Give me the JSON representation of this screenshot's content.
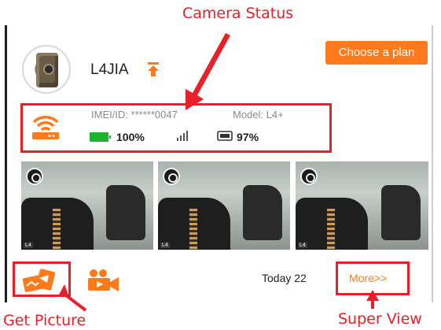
{
  "annotations": {
    "camera_status": "Camera Status",
    "get_picture": "Get Picture",
    "super_view": "Super View"
  },
  "camera": {
    "name": "L4JIA",
    "imei_label": "IMEI/ID: ******0047",
    "model_label": "Model: L4+",
    "battery": "100%",
    "storage": "97%"
  },
  "header": {
    "choose_plan_label": "Choose a plan"
  },
  "photos": {
    "tag": "L4",
    "count": 3
  },
  "footer": {
    "today_label": "Today 22",
    "more_label": "More>>"
  },
  "colors": {
    "accent": "#ff7a1a",
    "annotation": "#e8202a",
    "battery": "#1db32c"
  },
  "icons": [
    "pin-icon",
    "wifi-router-icon",
    "battery-icon",
    "signal-icon",
    "sd-card-icon",
    "view-icon",
    "get-picture-icon",
    "video-camera-icon"
  ]
}
